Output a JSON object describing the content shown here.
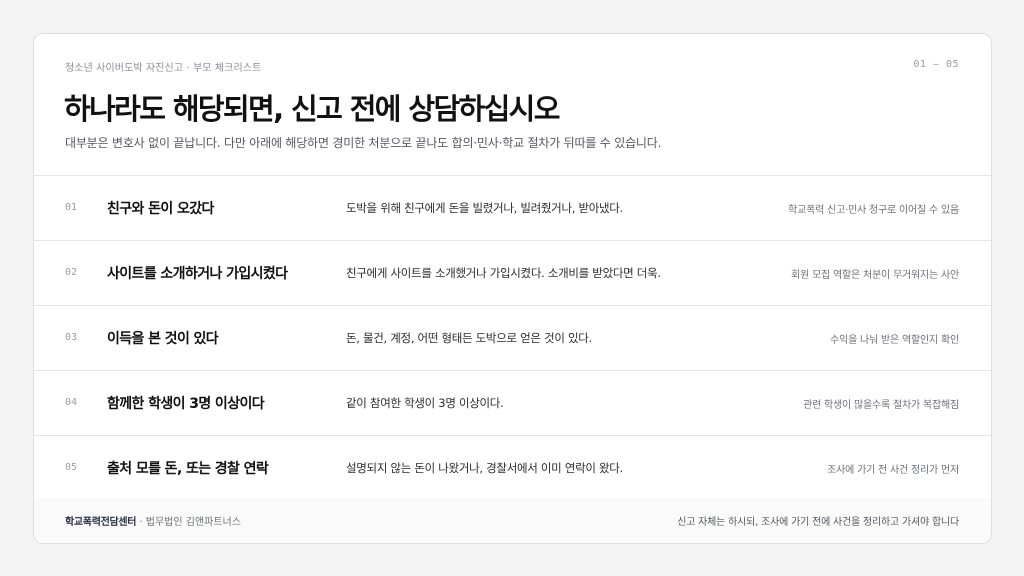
{
  "header": {
    "eyebrow": "청소년 사이버도박 자진신고 · 부모 체크리스트",
    "pager": "01 — 05",
    "title": "하나라도 해당되면, 신고 전에 상담하십시오",
    "subtitle": "대부분은 변호사 없이 끝납니다. 다만 아래에 해당하면 경미한 처분으로 끝나도 합의·민사·학교 절차가 뒤따를 수 있습니다."
  },
  "rows": [
    {
      "num": "01",
      "title": "친구와 돈이 오갔다",
      "desc": "도박을 위해 친구에게 돈을 빌렸거나, 빌려줬거나, 받아냈다.",
      "note": "학교폭력 신고·민사 청구로 이어질 수 있음"
    },
    {
      "num": "02",
      "title": "사이트를 소개하거나 가입시켰다",
      "desc": "친구에게 사이트를 소개했거나 가입시켰다. 소개비를 받았다면 더욱.",
      "note": "회원 모집 역할은 처분이 무거워지는 사안"
    },
    {
      "num": "03",
      "title": "이득을 본 것이 있다",
      "desc": "돈, 물건, 계정, 어떤 형태든 도박으로 얻은 것이 있다.",
      "note": "수익을 나눠 받은 역할인지 확인"
    },
    {
      "num": "04",
      "title": "함께한 학생이 3명 이상이다",
      "desc": "같이 참여한 학생이 3명 이상이다.",
      "note": "관련 학생이 많을수록 절차가 복잡해짐"
    },
    {
      "num": "05",
      "title": "출처 모를 돈, 또는 경찰 연락",
      "desc": "설명되지 않는 돈이 나왔거나, 경찰서에서 이미 연락이 왔다.",
      "note": "조사에 가기 전 사건 정리가 먼저"
    }
  ],
  "footer": {
    "org": "학교폭력전담센터",
    "firm": " · 법무법인 김앤파트너스",
    "note": "신고 자체는 하시되, 조사에 가기 전에 사건을 정리하고 가셔야 합니다"
  }
}
